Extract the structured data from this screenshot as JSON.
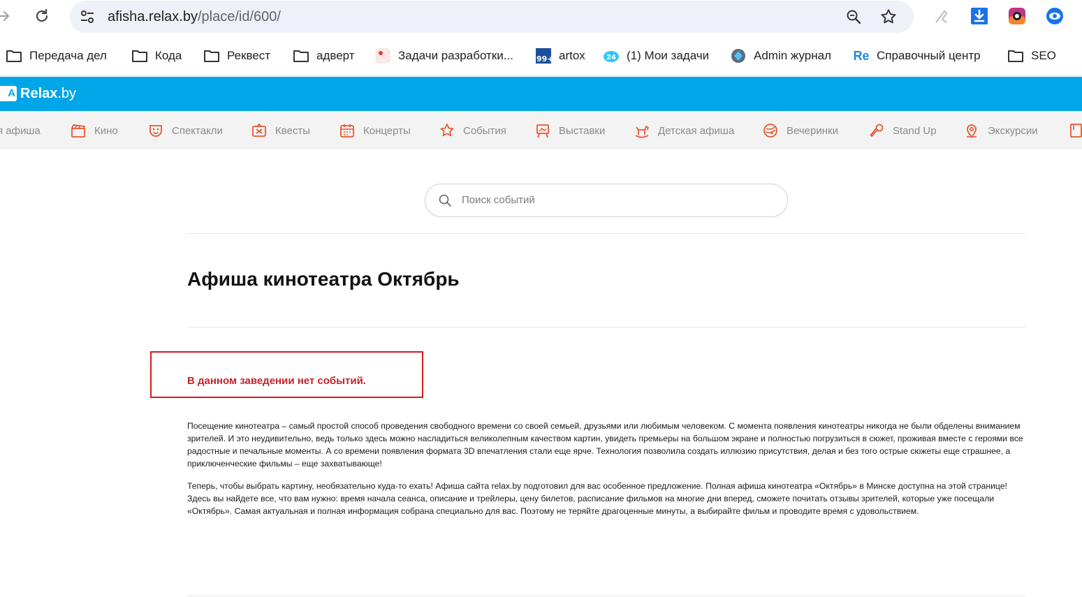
{
  "browser": {
    "url_host": "afisha.relax.by",
    "url_path": "/place/id/600/"
  },
  "bookmarks": [
    {
      "label": "Передача дел",
      "icon": "folder-icon"
    },
    {
      "label": "Кода",
      "icon": "folder-icon"
    },
    {
      "label": "Реквест",
      "icon": "folder-icon"
    },
    {
      "label": "адверт",
      "icon": "folder-icon"
    },
    {
      "label": "Задачи разработки...",
      "icon": "tasks-favicon"
    },
    {
      "label": "artox",
      "icon": "artox-favicon"
    },
    {
      "label": "(1) Мои задачи",
      "icon": "bitrix24-favicon"
    },
    {
      "label": "Admin журнал",
      "icon": "admin-favicon"
    },
    {
      "label": "Справочный центр",
      "icon": "re-favicon"
    },
    {
      "label": "SEO",
      "icon": "folder-icon"
    }
  ],
  "bookmark_badges": {
    "artox": "99+",
    "bitrix": "24",
    "re": "Re"
  },
  "site": {
    "logo_mark": "A",
    "logo_name": "Relax",
    "logo_domain": ".by",
    "brand_color": "#00a6e8"
  },
  "categories": [
    {
      "label": "я афиша",
      "icon": "poster-icon"
    },
    {
      "label": "Кино",
      "icon": "clapperboard-icon"
    },
    {
      "label": "Спектакли",
      "icon": "theater-mask-icon"
    },
    {
      "label": "Квесты",
      "icon": "quest-icon"
    },
    {
      "label": "Концерты",
      "icon": "calendar-icon"
    },
    {
      "label": "События",
      "icon": "star-icon"
    },
    {
      "label": "Выставки",
      "icon": "easel-icon"
    },
    {
      "label": "Детская афиша",
      "icon": "rocking-horse-icon"
    },
    {
      "label": "Вечеринки",
      "icon": "disco-icon"
    },
    {
      "label": "Stand Up",
      "icon": "microphone-icon"
    },
    {
      "label": "Экскурсии",
      "icon": "location-pin-icon"
    }
  ],
  "search": {
    "placeholder": "Поиск событий"
  },
  "page": {
    "title": "Афиша кинотеатра Октябрь",
    "no_events": "В данном заведении нет событий.",
    "paragraphs": [
      "Посещение кинотеатра – самый простой способ проведения свободного времени со своей семьей, друзьями или любимым человеком. С момента появления кинотеатры никогда не были обделены вниманием зрителей. И это неудивительно, ведь только здесь можно насладиться великолепным качеством картин, увидеть премьеры на большом экране и полностью погрузиться в сюжет, проживая вместе с героями все радостные и печальные моменты. А со времени появления формата 3D впечатления стали еще ярче. Технология позволила создать иллюзию присутствия, делая и без того острые сюжеты еще страшнее, а приключенческие фильмы – еще захватывающе!",
      "Теперь, чтобы выбрать картину, необязательно куда-то ехать! Афиша сайта relax.by подготовил для вас особенное предложение. Полная афиша кинотеатра «Октябрь» в Минске доступна на этой странице! Здесь вы найдете все, что вам нужно: время начала сеанса, описание и трейлеры, цену билетов, расписание фильмов на многие дни вперед, сможете почитать отзывы зрителей, которые уже посещали «Октябрь». Самая актуальная и полная информация собрана специально для вас. Поэтому не теряйте драгоценные минуты, а выбирайте фильм и проводите время с удовольствием."
    ]
  },
  "colors": {
    "category_icon": "#e8552f",
    "no_events_text": "#c3242a",
    "highlight_border": "#d71a1a"
  }
}
